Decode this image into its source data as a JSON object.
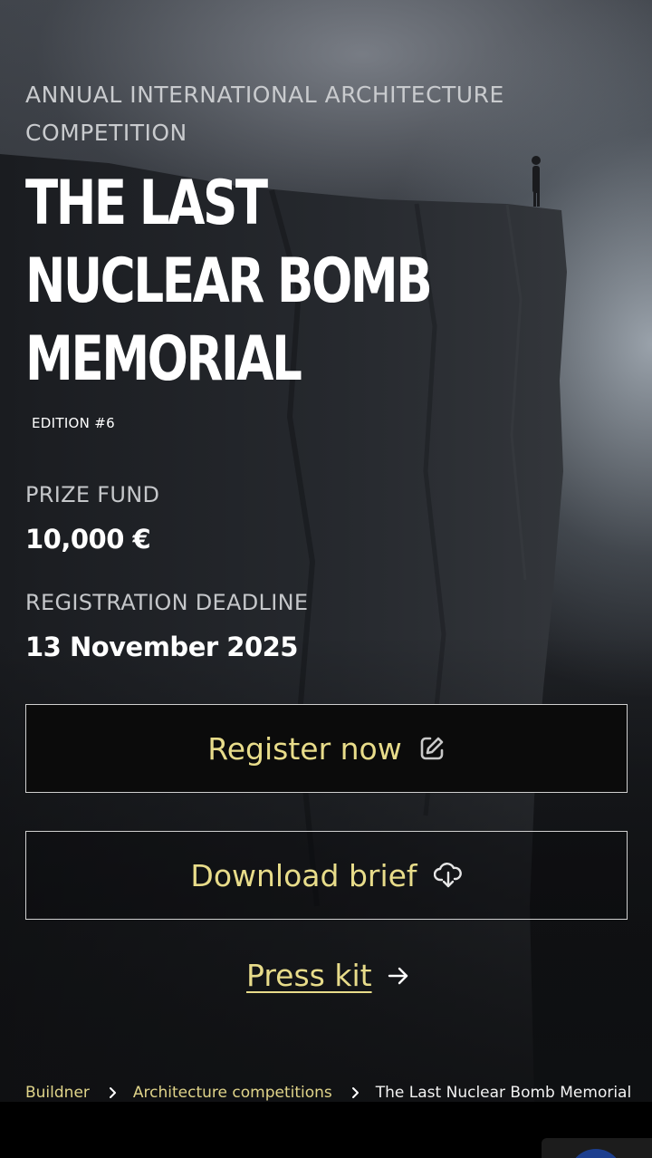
{
  "hero": {
    "overline": "ANNUAL INTERNATIONAL ARCHITECTURE COMPETITION",
    "title": "THE LAST NUCLEAR BOMB MEMORIAL",
    "edition": "EDITION #6"
  },
  "details": {
    "prize_label": "PRIZE FUND",
    "prize_value": "10,000 €",
    "deadline_label": "REGISTRATION DEADLINE",
    "deadline_value": "13 November 2025"
  },
  "actions": {
    "register_label": "Register now",
    "register_icon": "edit-icon",
    "download_label": "Download brief",
    "download_icon": "cloud-download-icon",
    "presskit_label": "Press kit",
    "presskit_icon": "arrow-right-icon"
  },
  "breadcrumb": {
    "items": [
      "Buildner",
      "Architecture competitions",
      "The Last Nuclear Bomb Memorial"
    ],
    "separator_icon": "chevron-right-icon"
  },
  "colors": {
    "accent": "#e8dc8a",
    "button_bg": "#0b0b0b",
    "border": "#d0d0d0"
  }
}
